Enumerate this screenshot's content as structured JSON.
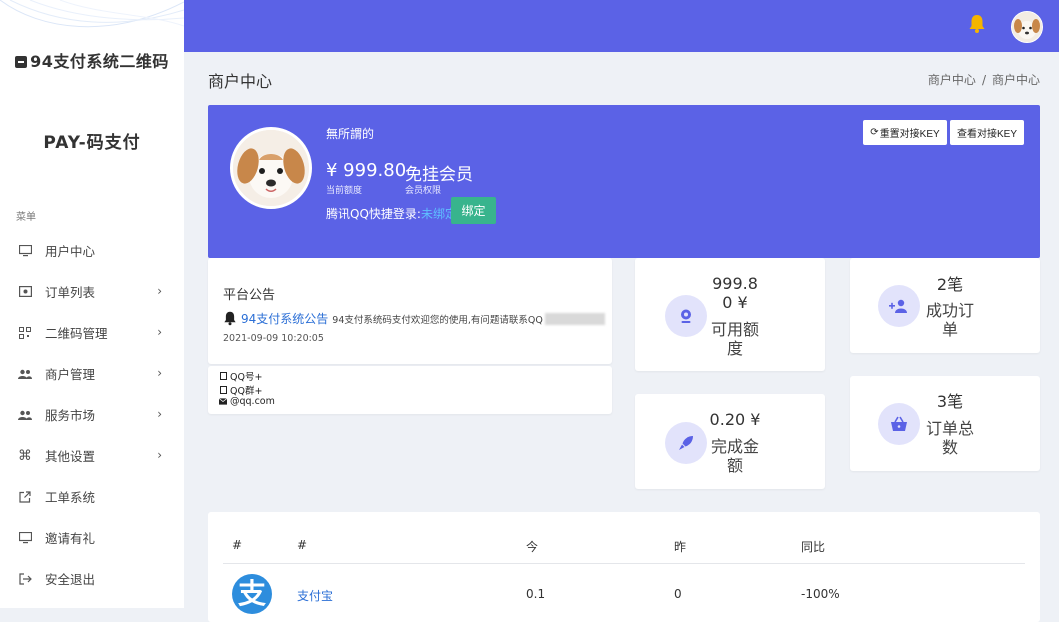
{
  "sidebar": {
    "brand": "94支付系统二维码",
    "subbrand": "PAY-码支付",
    "menu_title": "菜单",
    "items": [
      {
        "label": "用户中心",
        "has_children": false
      },
      {
        "label": "订单列表",
        "has_children": true
      },
      {
        "label": "二维码管理",
        "has_children": true
      },
      {
        "label": "商户管理",
        "has_children": true
      },
      {
        "label": "服务市场",
        "has_children": true
      },
      {
        "label": "其他设置",
        "has_children": true
      },
      {
        "label": "工单系统",
        "has_children": false
      },
      {
        "label": "邀请有礼",
        "has_children": false
      },
      {
        "label": "安全退出",
        "has_children": false
      }
    ]
  },
  "header": {
    "page_title": "商户中心",
    "breadcrumb": [
      "商户中心",
      "商户中心"
    ],
    "breadcrumb_sep": "/"
  },
  "profile": {
    "name": "無所謂的",
    "balance": "¥ 999.80",
    "balance_label": "当前额度",
    "member": "免挂会员",
    "member_label": "会员权限",
    "qq_prefix": "腾讯QQ快捷登录:",
    "qq_status": "未绑定",
    "bind_label": "绑定",
    "reset_key_label": "重置对接KEY",
    "view_key_label": "查看对接KEY"
  },
  "notice": {
    "title": "平台公告",
    "link": "94支付系统公告",
    "text": "94支付系统码支付欢迎您的使用,有问题请联系QQ",
    "date": "2021-09-09 10:20:05"
  },
  "contact": {
    "qq": "QQ号+",
    "qq_group": "QQ群+",
    "email": "@qq.com"
  },
  "stats": {
    "available": {
      "value_line1": "999.8",
      "value_line2": "0 ¥",
      "label_line1": "可用额",
      "label_line2": "度"
    },
    "success": {
      "value": "2笔",
      "label_line1": "成功订",
      "label_line2": "单"
    },
    "completed": {
      "value": "0.20 ¥",
      "label_line1": "完成金",
      "label_line2": "额"
    },
    "total": {
      "value": "3笔",
      "label_line1": "订单总",
      "label_line2": "数"
    }
  },
  "table": {
    "headers": [
      "#",
      "#",
      "今",
      "昨",
      "同比"
    ],
    "rows": [
      {
        "icon_text": "支",
        "name": "支付宝",
        "today": "0.1",
        "yesterday": "0",
        "ratio": "-100%"
      }
    ]
  },
  "colors": {
    "primary": "#5b62e6",
    "bind_green": "#38b48d",
    "link_blue": "#2b6fd6",
    "alipay_blue": "#2d8ddd",
    "bell_yellow": "#f5b400"
  }
}
